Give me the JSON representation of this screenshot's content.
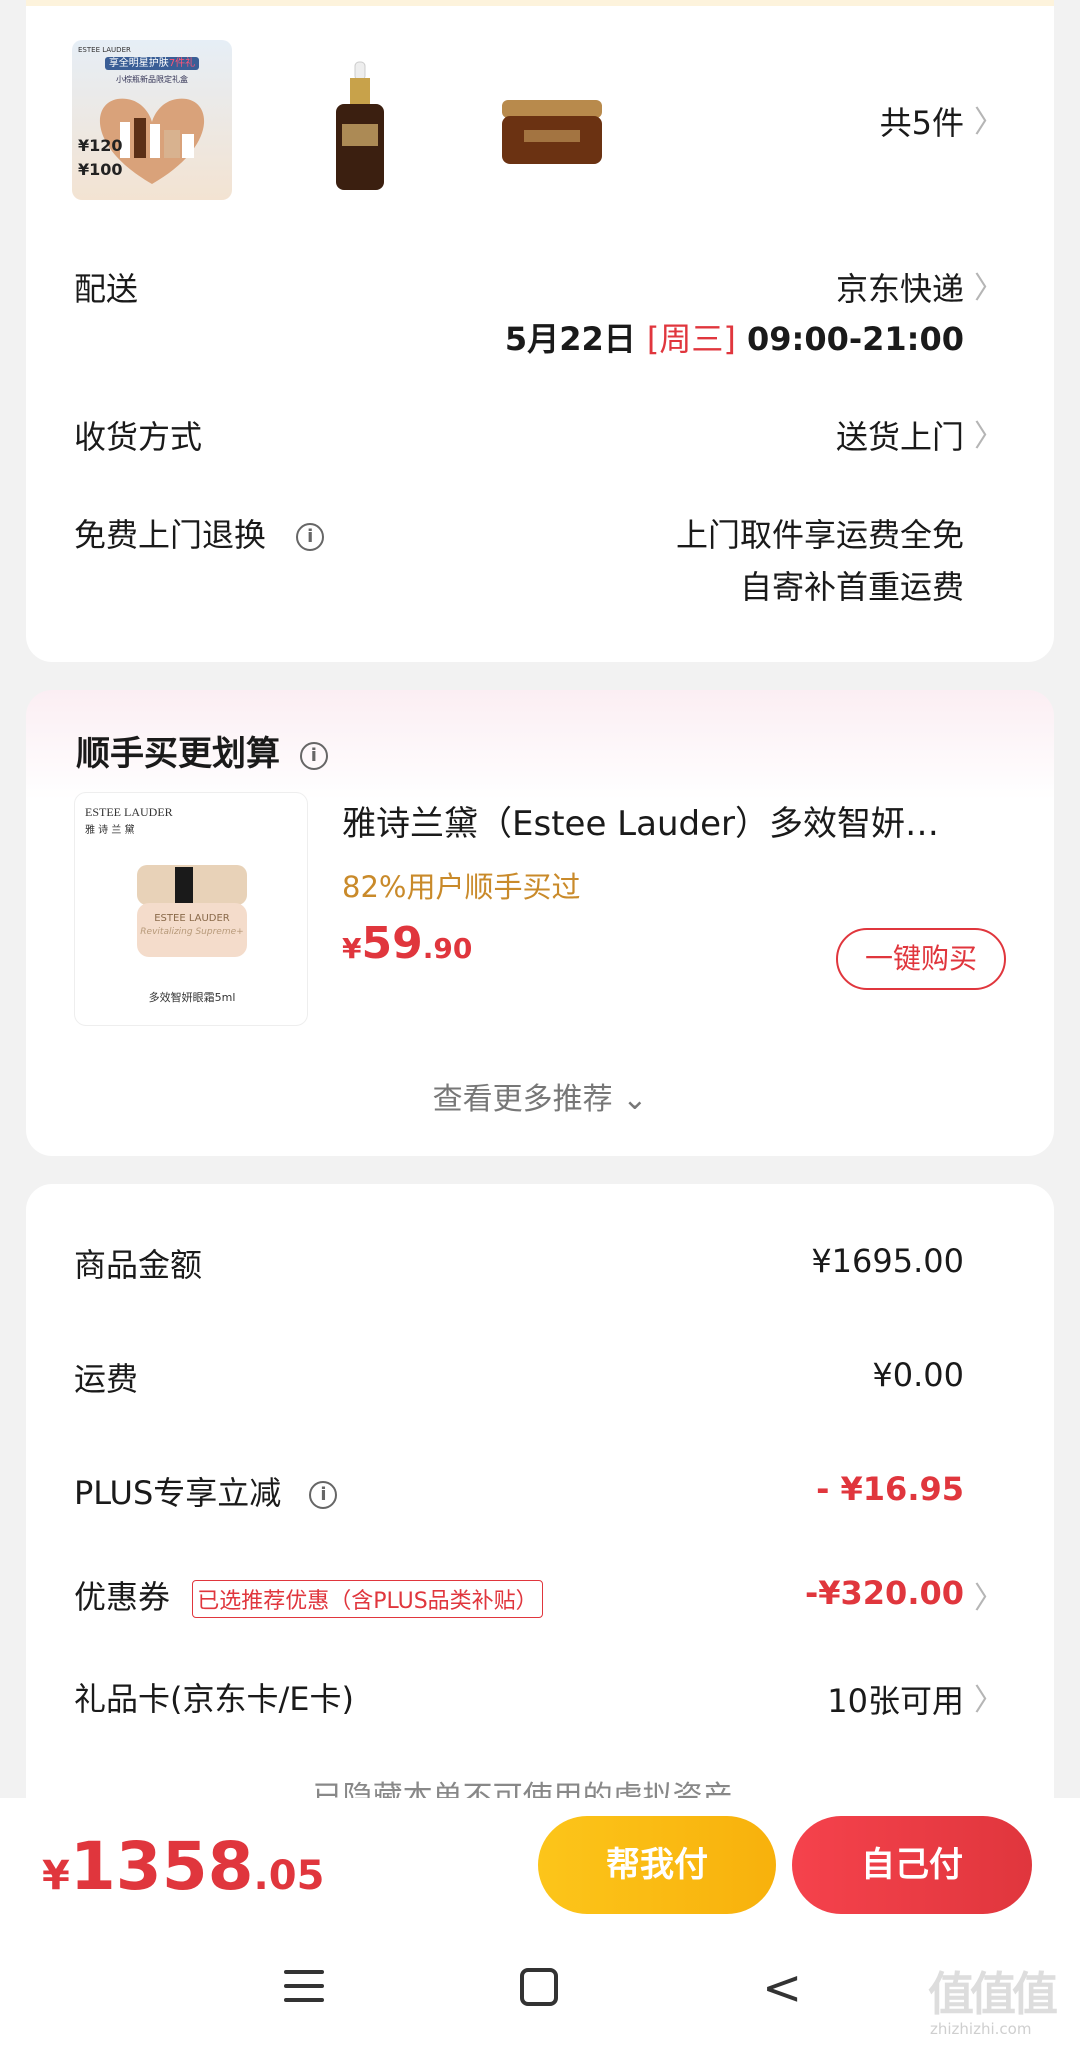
{
  "order_items": {
    "count_label": "共5件",
    "thumbs": [
      {
        "name": "gift-set",
        "caption_top": "享全明星护肤",
        "caption_highlight": "7件礼",
        "caption_sub": "小棕瓶新品限定礼盒",
        "price_1": "120",
        "price_2": "100"
      },
      {
        "name": "serum-bottle"
      },
      {
        "name": "eye-cream-jar"
      }
    ]
  },
  "delivery": {
    "label": "配送",
    "carrier": "京东快递",
    "date": "5月22日",
    "weekday": "[周三]",
    "time": "09:00-21:00"
  },
  "receive": {
    "label": "收货方式",
    "value": "送货上门"
  },
  "returns": {
    "label": "免费上门退换",
    "line1": "上门取件享运费全免",
    "line2": "自寄补首重运费"
  },
  "recommend": {
    "title": "顺手买更划算",
    "brand_en": "ESTEE LAUDER",
    "brand_cn": "雅 诗 兰 黛",
    "jar_text": "ESTEE LAUDER",
    "jar_sub": "Revitalizing Supreme+",
    "img_caption": "多效智妍眼霜5ml",
    "product_name": "雅诗兰黛（Estee Lauder）多效智妍…",
    "stat": "82%用户顺手买过",
    "currency": "¥",
    "price_int": "59",
    "price_dec": ".90",
    "buy_label": "一键购买",
    "more_label": "查看更多推荐 ⌄"
  },
  "summary": {
    "rows": [
      {
        "label": "商品金额",
        "value": "¥1695.00"
      },
      {
        "label": "运费",
        "value": "¥0.00"
      },
      {
        "label": "PLUS专享立减",
        "value": "- ¥16.95"
      },
      {
        "label": "优惠券",
        "tag": "已选推荐优惠（含PLUS品类补贴）",
        "value": "-¥320.00"
      },
      {
        "label": "礼品卡(京东卡/E卡)",
        "value": "10张可用"
      }
    ],
    "hidden_note": "已隐藏本单不可使用的虚拟资产 ⌄"
  },
  "footer": {
    "currency": "¥",
    "total_int": "1358",
    "total_dec": ".05",
    "help_pay": "帮我付",
    "self_pay": "自己付"
  },
  "watermark": {
    "text": "值值值",
    "url": "zhizhizhi.com"
  },
  "colors": {
    "accent_red": "#e0363d",
    "orange_stat": "#c98a2a",
    "yellow_btn": "#fbbd12"
  }
}
